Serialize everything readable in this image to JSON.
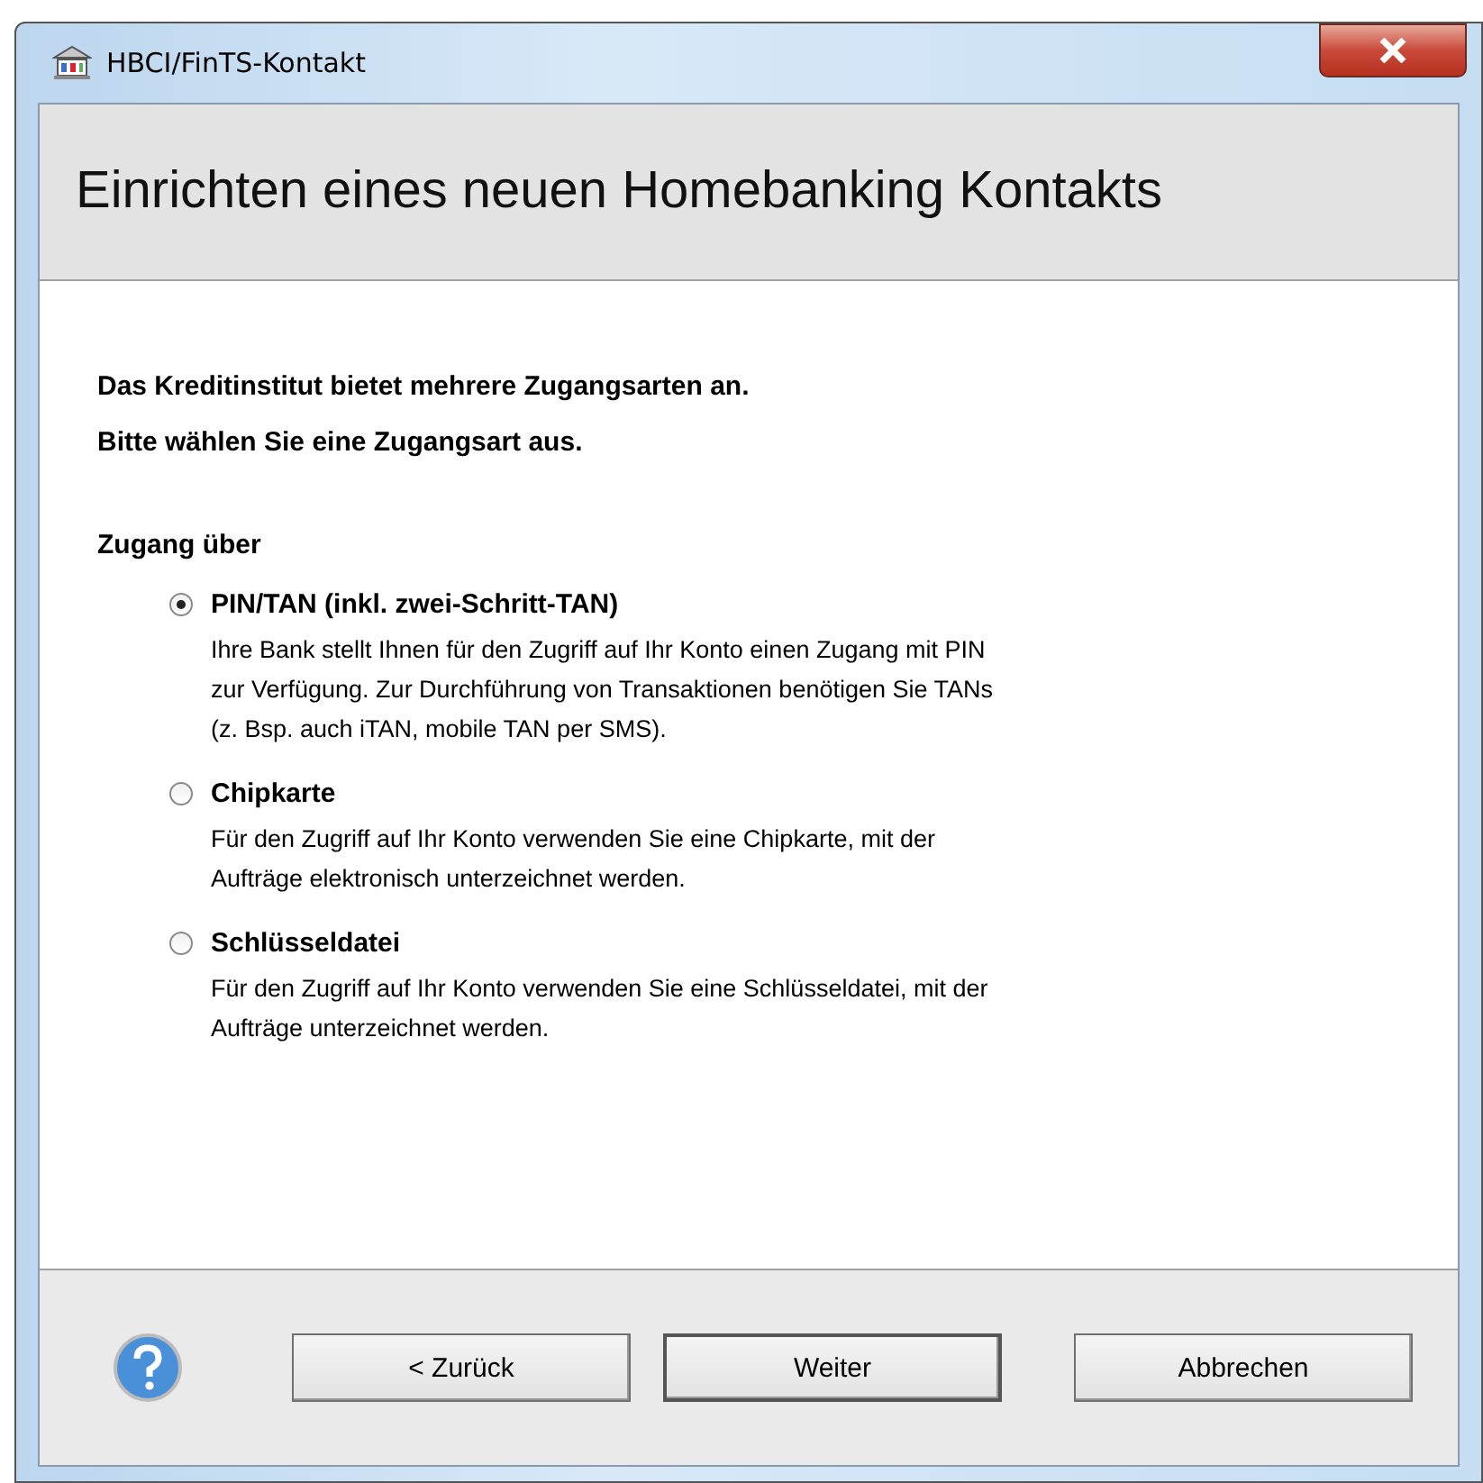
{
  "window": {
    "title": "HBCI/FinTS-Kontakt"
  },
  "header": {
    "title": "Einrichten eines neuen Homebanking Kontakts"
  },
  "intro": [
    "Das Kreditinstitut bietet mehrere Zugangsarten an.",
    "Bitte wählen Sie eine Zugangsart aus."
  ],
  "group_label": "Zugang über",
  "options": [
    {
      "label": "PIN/TAN (inkl. zwei-Schritt-TAN)",
      "selected": true,
      "description": "Ihre Bank stellt Ihnen für den Zugriff auf Ihr Konto einen Zugang mit PIN zur Verfügung. Zur Durchführung von Transaktionen benötigen Sie TANs (z. Bsp. auch iTAN, mobile TAN per SMS)."
    },
    {
      "label": "Chipkarte",
      "selected": false,
      "description": "Für den Zugriff auf Ihr Konto verwenden Sie eine Chipkarte, mit der Aufträge elektronisch unterzeichnet werden."
    },
    {
      "label": "Schlüsseldatei",
      "selected": false,
      "description": "Für den Zugriff auf Ihr Konto verwenden Sie eine Schlüsseldatei, mit der Aufträge unterzeichnet werden."
    }
  ],
  "buttons": [
    {
      "label": "< Zurück",
      "default": false
    },
    {
      "label": "Weiter",
      "default": true
    },
    {
      "label": "Abbrechen",
      "default": false
    }
  ]
}
